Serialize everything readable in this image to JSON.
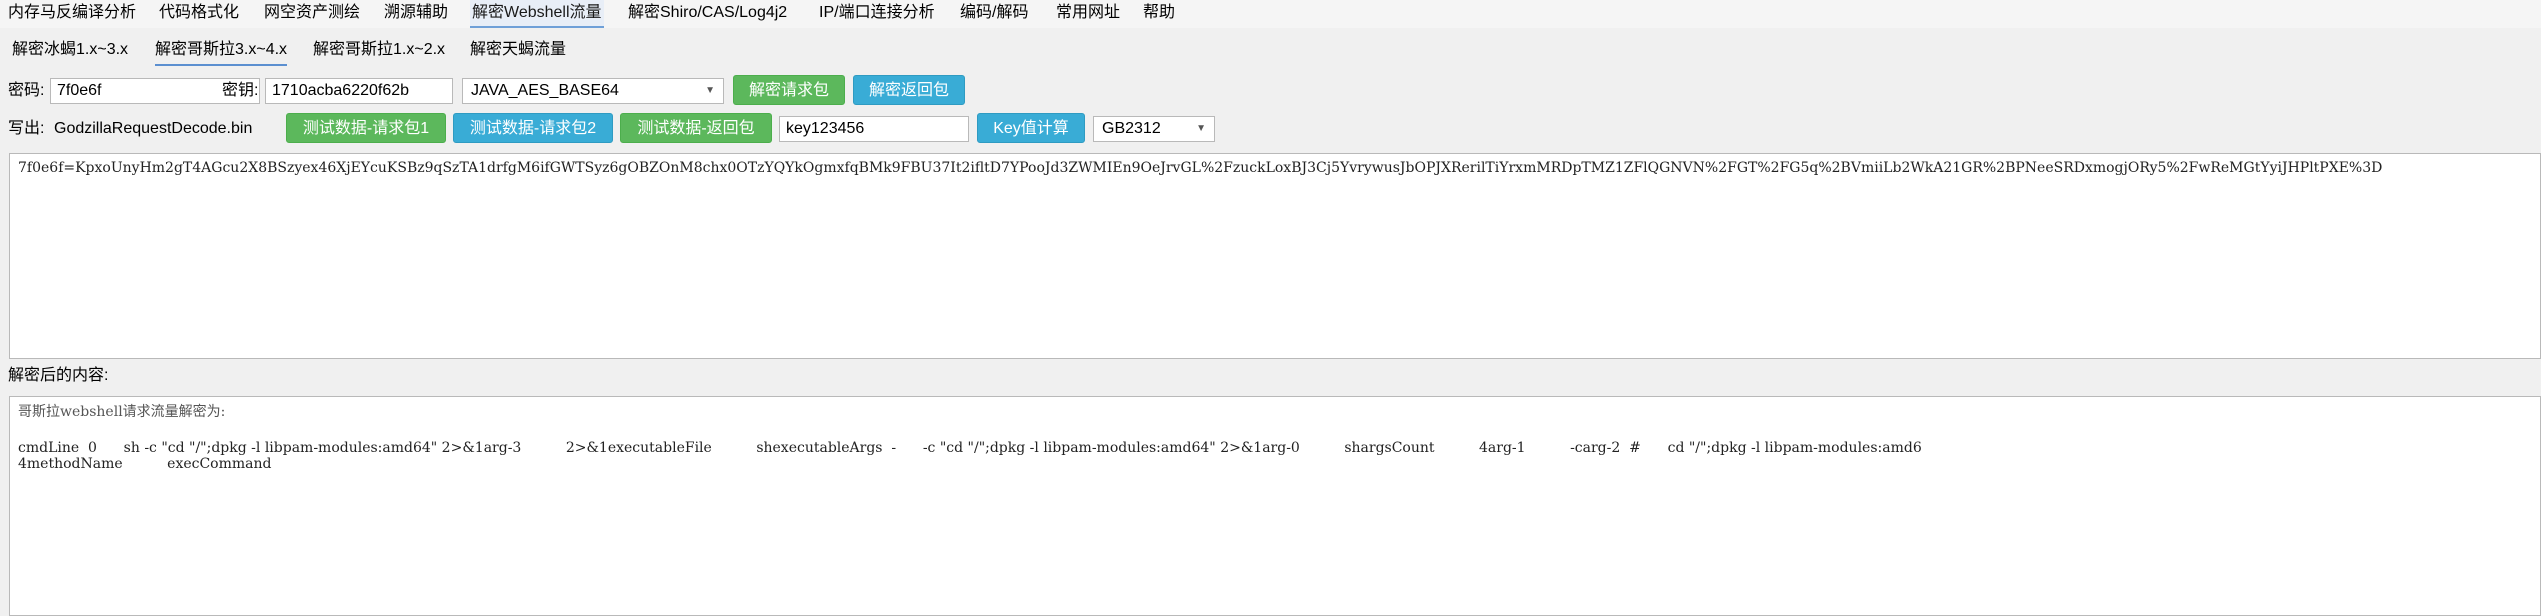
{
  "menu": {
    "items": [
      {
        "label": "内存马反编译分析"
      },
      {
        "label": "代码格式化"
      },
      {
        "label": "网空资产测绘"
      },
      {
        "label": "溯源辅助"
      },
      {
        "label": "解密Webshell流量"
      },
      {
        "label": "解密Shiro/CAS/Log4j2"
      },
      {
        "label": "IP/端口连接分析"
      },
      {
        "label": "编码/解码"
      },
      {
        "label": "常用网址"
      },
      {
        "label": "帮助"
      }
    ]
  },
  "subtabs": {
    "items": [
      {
        "label": "解密冰蝎1.x~3.x"
      },
      {
        "label": "解密哥斯拉3.x~4.x"
      },
      {
        "label": "解密哥斯拉1.x~2.x"
      },
      {
        "label": "解密天蝎流量"
      }
    ]
  },
  "form": {
    "password_label": "密码:",
    "password_value": "7f0e6f",
    "key_label": "密钥:",
    "key_value": "1710acba6220f62b",
    "mode_value": "JAVA_AES_BASE64",
    "decrypt_request_label": "解密请求包",
    "decrypt_response_label": "解密返回包",
    "output_label": "写出:",
    "output_file": "GodzillaRequestDecode.bin",
    "test_req1_label": "测试数据-请求包1",
    "test_req2_label": "测试数据-请求包2",
    "test_resp_label": "测试数据-返回包",
    "key_input_value": "key123456",
    "key_calc_label": "Key值计算",
    "charset_value": "GB2312"
  },
  "input_text": "7f0e6f=KpxoUnyHm2gT4AGcu2X8BSzyex46XjEYcuKSBz9qSzTA1drfgM6ifGWTSyz6gOBZOnM8chx0OTzYQYkOgmxfqBMk9FBU37It2ifltD7YPooJd3ZWMIEn9OeJrvGL%2FzuckLoxBJ3Cj5YvrywusJbOPJXRerilTiYrxmMRDpTMZ1ZFlQGNVN%2FGT%2FG5q%2BVmiiLb2WkA21GR%2BPNeeSRDxmogjORy5%2FwReMGtYyiJHPltPXE%3D",
  "result": {
    "label": "解密后的内容:",
    "header": "哥斯拉webshell请求流量解密为:",
    "line1": "cmdLine  0      sh -c \"cd \"/\";dpkg -l libpam-modules:amd64\" 2>&1arg-3          2>&1executableFile          shexecutableArgs  -      -c \"cd \"/\";dpkg -l libpam-modules:amd64\" 2>&1arg-0          shargsCount          4arg-1          -carg-2  #      cd \"/\";dpkg -l libpam-modules:amd6",
    "line2": "4methodName          execCommand"
  }
}
